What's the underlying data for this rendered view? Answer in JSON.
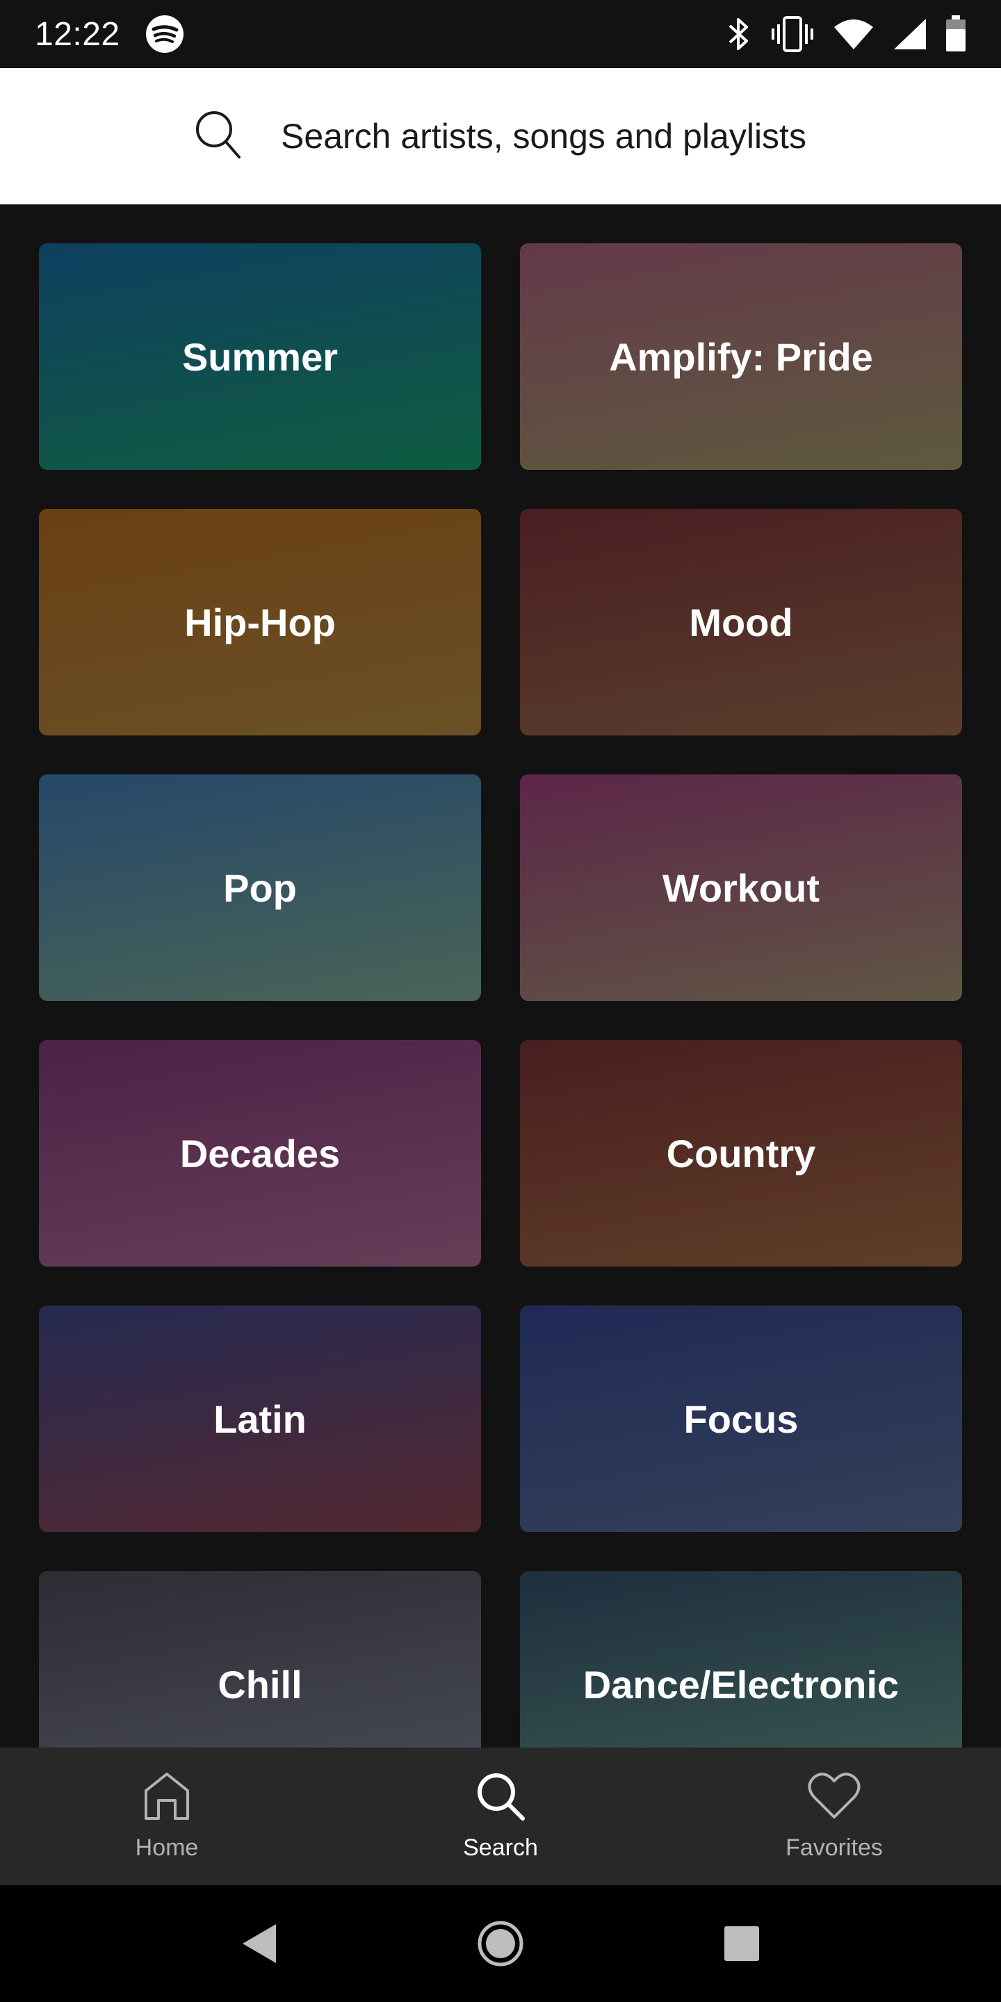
{
  "status_bar": {
    "time": "12:22",
    "app_icon": "spotify-icon",
    "icons": [
      "bluetooth-icon",
      "vibrate-icon",
      "wifi-icon",
      "signal-icon",
      "battery-icon"
    ]
  },
  "search": {
    "icon": "search-icon",
    "placeholder": "Search artists, songs and playlists"
  },
  "categories": [
    {
      "label": "Summer",
      "colors": [
        "#0f4060",
        "#0f5c40"
      ]
    },
    {
      "label": "Amplify: Pride",
      "colors": [
        "#64394a",
        "#5e5a3e"
      ]
    },
    {
      "label": "Hip-Hop",
      "colors": [
        "#6a4014",
        "#6a5026"
      ]
    },
    {
      "label": "Mood",
      "colors": [
        "#4a1e22",
        "#5a3e2c"
      ]
    },
    {
      "label": "Pop",
      "colors": [
        "#25486a",
        "#4a6456"
      ]
    },
    {
      "label": "Workout",
      "colors": [
        "#5c2648",
        "#605644"
      ]
    },
    {
      "label": "Decades",
      "colors": [
        "#4c2246",
        "#663e58"
      ]
    },
    {
      "label": "Country",
      "colors": [
        "#481e20",
        "#603e28"
      ]
    },
    {
      "label": "Latin",
      "colors": [
        "#262a52",
        "#532830"
      ]
    },
    {
      "label": "Focus",
      "colors": [
        "#1e2a54",
        "#35405a"
      ]
    },
    {
      "label": "Chill",
      "colors": [
        "#2e2c34",
        "#484c58"
      ]
    },
    {
      "label": "Dance/Electronic",
      "colors": [
        "#1e2e3e",
        "#3a5a52"
      ]
    }
  ],
  "bottom_nav": {
    "items": [
      {
        "label": "Home",
        "icon": "home-icon",
        "active": false
      },
      {
        "label": "Search",
        "icon": "search-icon",
        "active": true
      },
      {
        "label": "Favorites",
        "icon": "heart-icon",
        "active": false
      }
    ]
  },
  "system_nav": {
    "icons": [
      "back-icon",
      "home-circle-icon",
      "recents-icon"
    ]
  },
  "colors": {
    "background": "#121212",
    "search_bar": "#ffffff",
    "bottom_nav": "#282828",
    "nav_inactive": "#b3b3b3",
    "nav_active": "#ffffff"
  }
}
